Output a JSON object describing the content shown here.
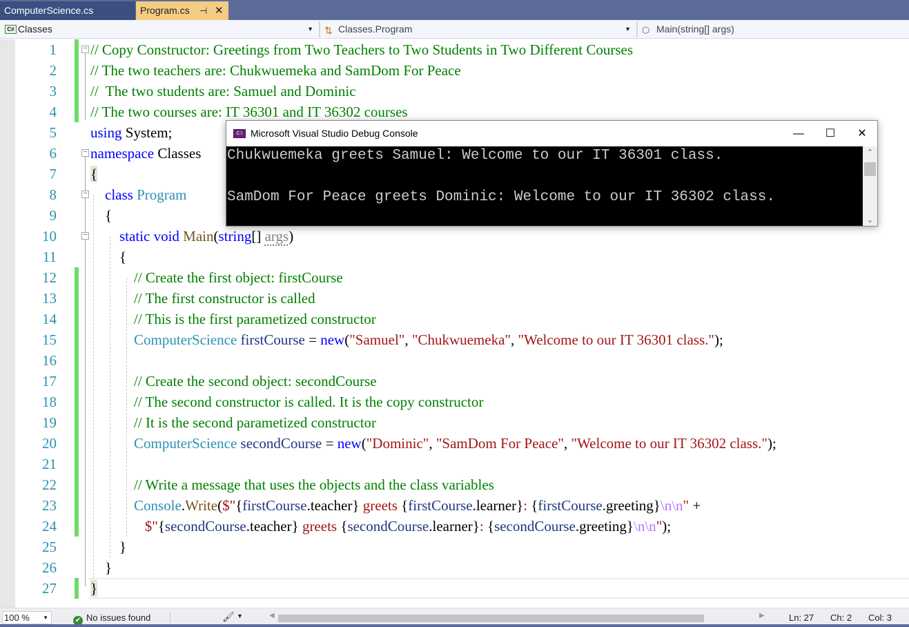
{
  "tabs": [
    {
      "label": "ComputerScience.cs",
      "active": false
    },
    {
      "label": "Program.cs",
      "active": true
    }
  ],
  "tab_icons": {
    "pin": "⊣",
    "close": "✕"
  },
  "navbar": {
    "project": "Classes",
    "project_badge": "C#",
    "class": "Classes.Program",
    "member": "Main(string[] args)"
  },
  "editor": {
    "line_numbers": [
      "1",
      "2",
      "3",
      "4",
      "5",
      "6",
      "7",
      "8",
      "9",
      "10",
      "11",
      "12",
      "13",
      "14",
      "15",
      "16",
      "17",
      "18",
      "19",
      "20",
      "21",
      "22",
      "23",
      "24",
      "25",
      "26",
      "27"
    ],
    "lines": [
      [
        {
          "t": "// Copy Constructor: Greetings from Two Teachers to Two Students in Two Different Courses",
          "c": "cm"
        }
      ],
      [
        {
          "t": "// The two teachers are: Chukwuemeka and SamDom For Peace",
          "c": "cm"
        }
      ],
      [
        {
          "t": "//  The two students are: Samuel and Dominic",
          "c": "cm"
        }
      ],
      [
        {
          "t": "// The two courses are: IT 36301 and IT 36302 courses",
          "c": "cm"
        }
      ],
      [
        {
          "t": "using",
          "c": "kw"
        },
        {
          "t": " System;",
          "c": ""
        }
      ],
      [
        {
          "t": "namespace",
          "c": "kw"
        },
        {
          "t": " Classes",
          "c": ""
        }
      ],
      [
        {
          "t": "{",
          "c": "brace"
        }
      ],
      [
        {
          "t": "    ",
          "c": ""
        },
        {
          "t": "class",
          "c": "kw"
        },
        {
          "t": " ",
          "c": ""
        },
        {
          "t": "Program",
          "c": "ty"
        }
      ],
      [
        {
          "t": "    {",
          "c": ""
        }
      ],
      [
        {
          "t": "        ",
          "c": ""
        },
        {
          "t": "static",
          "c": "kw"
        },
        {
          "t": " ",
          "c": ""
        },
        {
          "t": "void",
          "c": "kw"
        },
        {
          "t": " ",
          "c": ""
        },
        {
          "t": "Main",
          "c": "fn"
        },
        {
          "t": "(",
          "c": ""
        },
        {
          "t": "string",
          "c": "kw"
        },
        {
          "t": "[] ",
          "c": ""
        },
        {
          "t": "args",
          "c": "par"
        },
        {
          "t": ")",
          "c": ""
        }
      ],
      [
        {
          "t": "        {",
          "c": ""
        }
      ],
      [
        {
          "t": "            ",
          "c": ""
        },
        {
          "t": "// Create the first object: firstCourse",
          "c": "cm"
        }
      ],
      [
        {
          "t": "            ",
          "c": ""
        },
        {
          "t": "// The first constructor is called",
          "c": "cm"
        }
      ],
      [
        {
          "t": "            ",
          "c": ""
        },
        {
          "t": "// This is the first parametized constructor",
          "c": "cm"
        }
      ],
      [
        {
          "t": "            ",
          "c": ""
        },
        {
          "t": "ComputerScience",
          "c": "ty"
        },
        {
          "t": " ",
          "c": ""
        },
        {
          "t": "firstCourse",
          "c": "var"
        },
        {
          "t": " = ",
          "c": ""
        },
        {
          "t": "new",
          "c": "kw"
        },
        {
          "t": "(",
          "c": ""
        },
        {
          "t": "\"Samuel\"",
          "c": "st"
        },
        {
          "t": ", ",
          "c": ""
        },
        {
          "t": "\"Chukwuemeka\"",
          "c": "st"
        },
        {
          "t": ", ",
          "c": ""
        },
        {
          "t": "\"Welcome to our IT 36301 class.\"",
          "c": "st"
        },
        {
          "t": ");",
          "c": ""
        }
      ],
      [],
      [
        {
          "t": "            ",
          "c": ""
        },
        {
          "t": "// Create the second object: secondCourse",
          "c": "cm"
        }
      ],
      [
        {
          "t": "            ",
          "c": ""
        },
        {
          "t": "// The second constructor is called. It is the copy constructor",
          "c": "cm"
        }
      ],
      [
        {
          "t": "            ",
          "c": ""
        },
        {
          "t": "// It is the second parametized constructor",
          "c": "cm"
        }
      ],
      [
        {
          "t": "            ",
          "c": ""
        },
        {
          "t": "ComputerScience",
          "c": "ty"
        },
        {
          "t": " ",
          "c": ""
        },
        {
          "t": "secondCourse",
          "c": "var"
        },
        {
          "t": " = ",
          "c": ""
        },
        {
          "t": "new",
          "c": "kw"
        },
        {
          "t": "(",
          "c": ""
        },
        {
          "t": "\"Dominic\"",
          "c": "st"
        },
        {
          "t": ", ",
          "c": ""
        },
        {
          "t": "\"SamDom For Peace\"",
          "c": "st"
        },
        {
          "t": ", ",
          "c": ""
        },
        {
          "t": "\"Welcome to our IT 36302 class.\"",
          "c": "st"
        },
        {
          "t": ");",
          "c": ""
        }
      ],
      [],
      [
        {
          "t": "            ",
          "c": ""
        },
        {
          "t": "// Write a message that uses the objects and the class variables",
          "c": "cm"
        }
      ],
      [
        {
          "t": "            ",
          "c": ""
        },
        {
          "t": "Console",
          "c": "ty"
        },
        {
          "t": ".",
          "c": ""
        },
        {
          "t": "Write",
          "c": "fn"
        },
        {
          "t": "(",
          "c": ""
        },
        {
          "t": "$\"",
          "c": "st"
        },
        {
          "t": "{",
          "c": ""
        },
        {
          "t": "firstCourse",
          "c": "var"
        },
        {
          "t": ".teacher}",
          "c": ""
        },
        {
          "t": " greets ",
          "c": "st"
        },
        {
          "t": "{",
          "c": ""
        },
        {
          "t": "firstCourse",
          "c": "var"
        },
        {
          "t": ".learner}",
          "c": ""
        },
        {
          "t": ": ",
          "c": "st"
        },
        {
          "t": "{",
          "c": ""
        },
        {
          "t": "firstCourse",
          "c": "var"
        },
        {
          "t": ".greeting}",
          "c": ""
        },
        {
          "t": "\\n\\n",
          "c": "esc"
        },
        {
          "t": "\"",
          "c": "st"
        },
        {
          "t": " +",
          "c": ""
        }
      ],
      [
        {
          "t": "               ",
          "c": ""
        },
        {
          "t": "$\"",
          "c": "st"
        },
        {
          "t": "{",
          "c": ""
        },
        {
          "t": "secondCourse",
          "c": "var"
        },
        {
          "t": ".teacher}",
          "c": ""
        },
        {
          "t": " greets ",
          "c": "st"
        },
        {
          "t": "{",
          "c": ""
        },
        {
          "t": "secondCourse",
          "c": "var"
        },
        {
          "t": ".learner}",
          "c": ""
        },
        {
          "t": ": ",
          "c": "st"
        },
        {
          "t": "{",
          "c": ""
        },
        {
          "t": "secondCourse",
          "c": "var"
        },
        {
          "t": ".greeting}",
          "c": ""
        },
        {
          "t": "\\n\\n",
          "c": "esc"
        },
        {
          "t": "\"",
          "c": "st"
        },
        {
          "t": ");",
          "c": ""
        }
      ],
      [
        {
          "t": "        }",
          "c": ""
        }
      ],
      [
        {
          "t": "    }",
          "c": ""
        }
      ],
      [
        {
          "t": "}",
          "c": "brace"
        }
      ]
    ],
    "changed_lines": [
      1,
      2,
      3,
      4,
      12,
      13,
      14,
      15,
      16,
      17,
      18,
      19,
      20,
      21,
      22,
      23,
      24,
      27
    ],
    "fold_lines": [
      1,
      6,
      8,
      10
    ],
    "current_line": 27
  },
  "console": {
    "title": "Microsoft Visual Studio Debug Console",
    "icon_text": "C:\\",
    "lines": [
      "Chukwuemeka greets Samuel: Welcome to our IT 36301 class.",
      "",
      "SamDom For Peace greets Dominic: Welcome to our IT 36302 class."
    ],
    "buttons": {
      "minimize": "—",
      "maximize": "☐",
      "close": "✕"
    }
  },
  "statusbar": {
    "zoom": "100 %",
    "issues": "No issues found",
    "line": "Ln: 27",
    "char": "Ch: 2",
    "col": "Col: 3"
  },
  "colors": {
    "tab_active": "#f5cc84",
    "tab_inactive": "#3b4f81",
    "chrome": "#5d6b99",
    "comment": "#008000",
    "keyword": "#0000ff",
    "type": "#2b91af",
    "string": "#a31515",
    "change_margin": "#6ddb6a"
  }
}
